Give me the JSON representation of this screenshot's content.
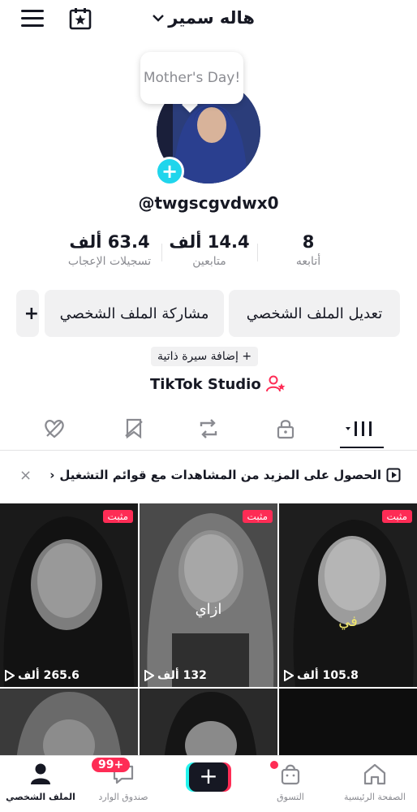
{
  "header": {
    "username": "هاله سمير",
    "menu_icon": "hamburger-menu-icon",
    "calendar_icon": "calendar-star-icon"
  },
  "profile": {
    "bubble_text": "Mother's Day!",
    "handle": "@twgscgvdwx0"
  },
  "stats": {
    "following": {
      "value": "8",
      "label": "أتابعه"
    },
    "followers": {
      "value": "14.4 ألف",
      "label": "متابعين"
    },
    "likes": {
      "value": "63.4 ألف",
      "label": "تسجيلات الإعجاب"
    }
  },
  "actions": {
    "edit_profile": "تعديل الملف الشخصي",
    "share_profile": "مشاركة الملف الشخصي",
    "add_friend": "+"
  },
  "bio": {
    "add_bio": "+ إضافة سيرة ذاتية"
  },
  "studio": {
    "label": "TikTok Studio"
  },
  "banner": {
    "text": "الحصول على المزيد من المشاهدات مع قوائم التشغيل",
    "chevron": "‹",
    "close": "×"
  },
  "videos": [
    {
      "pinned": "مثبت",
      "views": "105.8 ألف",
      "caption": "في"
    },
    {
      "pinned": "مثبت",
      "views": "132 ألف",
      "caption": "ازاي"
    },
    {
      "pinned": "مثبت",
      "views": "265.6 ألف",
      "caption": ""
    }
  ],
  "nav": {
    "home": "الصفحة الرئيسية",
    "shop": "التسوق",
    "create": "+",
    "inbox": "صندوق الوارد",
    "inbox_badge": "99+",
    "profile": "الملف الشخصي"
  },
  "colors": {
    "accent_pink": "#fe2c55",
    "accent_cyan": "#25f4ee",
    "text_primary": "#161823",
    "text_secondary": "#8a8b91",
    "button_bg": "#f1f1f2"
  }
}
